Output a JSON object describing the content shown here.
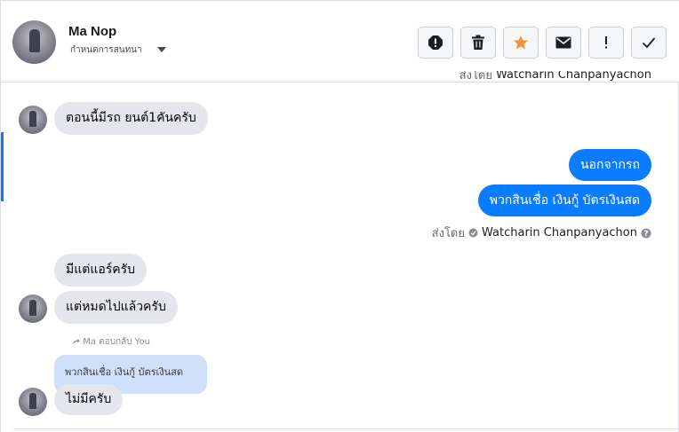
{
  "header": {
    "contact_name": "Ma Nop",
    "conversation_label": "กำหนดการสนทนา",
    "actions": [
      {
        "icon": "alert-icon",
        "name": "mark-spam-button"
      },
      {
        "icon": "trash-icon",
        "name": "delete-button"
      },
      {
        "icon": "star-icon",
        "name": "star-button"
      },
      {
        "icon": "envelope-icon",
        "name": "mark-unread-button"
      },
      {
        "icon": "exclamation-icon",
        "name": "follow-up-button"
      },
      {
        "icon": "check-icon",
        "name": "mark-done-button"
      }
    ],
    "star_color": "#f7923a"
  },
  "thread": {
    "top_sent_by": {
      "prefix": "ส่งโดย",
      "sender": "Watcharin Chanpanyachon"
    },
    "messages": [
      {
        "side": "in",
        "text": "ตอนนี้มีรถ ยนต์1คันครับ"
      },
      {
        "side": "out",
        "text": "นอกจากรถ"
      },
      {
        "side": "out",
        "text": "พวกสินเชื่อ เงินกู้ บัตรเงินสด"
      },
      {
        "side": "in",
        "text": "มีแต่แอร์ครับ"
      },
      {
        "side": "in",
        "text": "แต่หมดไปแล้วครับ"
      },
      {
        "side": "in",
        "text": "ไม่มีครับ"
      }
    ],
    "sent_by": {
      "prefix": "ส่งโดย",
      "sender": "Watcharin Chanpanyachon"
    },
    "reply": {
      "meta": "Ma ตอบกลับ You",
      "quote": "พวกสินเชื่อ เงินกู้ บัตรเงินสด"
    }
  },
  "colors": {
    "outgoing": "#0a7cff",
    "incoming": "#e4e6eb",
    "reply_quote": "#cfe0fb"
  }
}
